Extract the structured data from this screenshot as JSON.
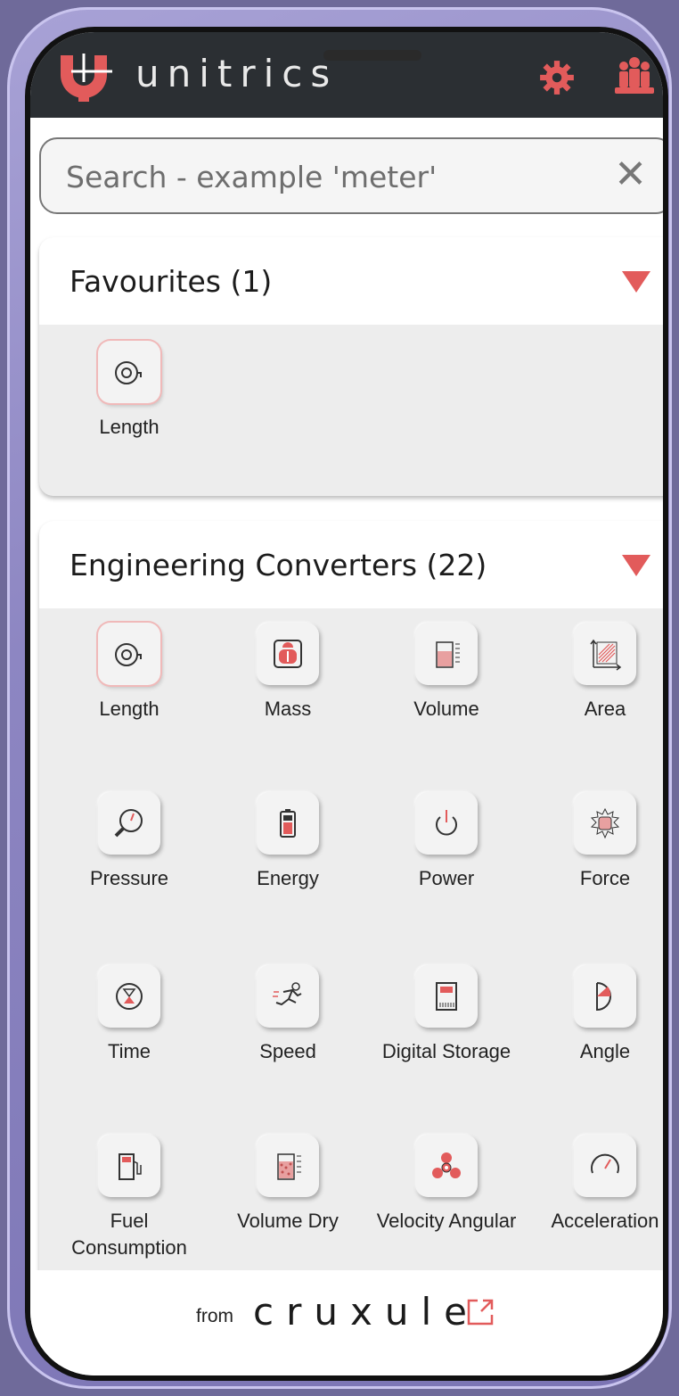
{
  "app": {
    "name": "unitrics"
  },
  "search": {
    "placeholder": "Search - example 'meter'",
    "clear": "✕"
  },
  "favourites": {
    "title": "Favourites (1)",
    "items": [
      {
        "label": "Length",
        "icon": "tape-measure-icon"
      }
    ]
  },
  "engineering": {
    "title": "Engineering Converters (22)",
    "items": [
      {
        "label": "Length",
        "icon": "tape-measure-icon"
      },
      {
        "label": "Mass",
        "icon": "scale-icon"
      },
      {
        "label": "Volume",
        "icon": "beaker-icon"
      },
      {
        "label": "Area",
        "icon": "area-icon"
      },
      {
        "label": "Pressure",
        "icon": "pressure-gauge-icon"
      },
      {
        "label": "Energy",
        "icon": "battery-icon"
      },
      {
        "label": "Power",
        "icon": "power-icon"
      },
      {
        "label": "Force",
        "icon": "fist-icon"
      },
      {
        "label": "Time",
        "icon": "hourglass-icon"
      },
      {
        "label": "Speed",
        "icon": "runner-icon"
      },
      {
        "label": "Digital Storage",
        "icon": "sd-card-icon"
      },
      {
        "label": "Angle",
        "icon": "protractor-icon"
      },
      {
        "label": "Fuel Consumption",
        "icon": "fuel-pump-icon"
      },
      {
        "label": "Volume Dry",
        "icon": "grain-container-icon"
      },
      {
        "label": "Velocity Angular",
        "icon": "fidget-spinner-icon"
      },
      {
        "label": "Acceleration",
        "icon": "speedometer-icon"
      }
    ]
  },
  "footer": {
    "from": "from",
    "brand": "cruxule"
  },
  "colors": {
    "accent": "#e25b5b",
    "header": "#2b2f33",
    "frame": "#8d86c2"
  }
}
